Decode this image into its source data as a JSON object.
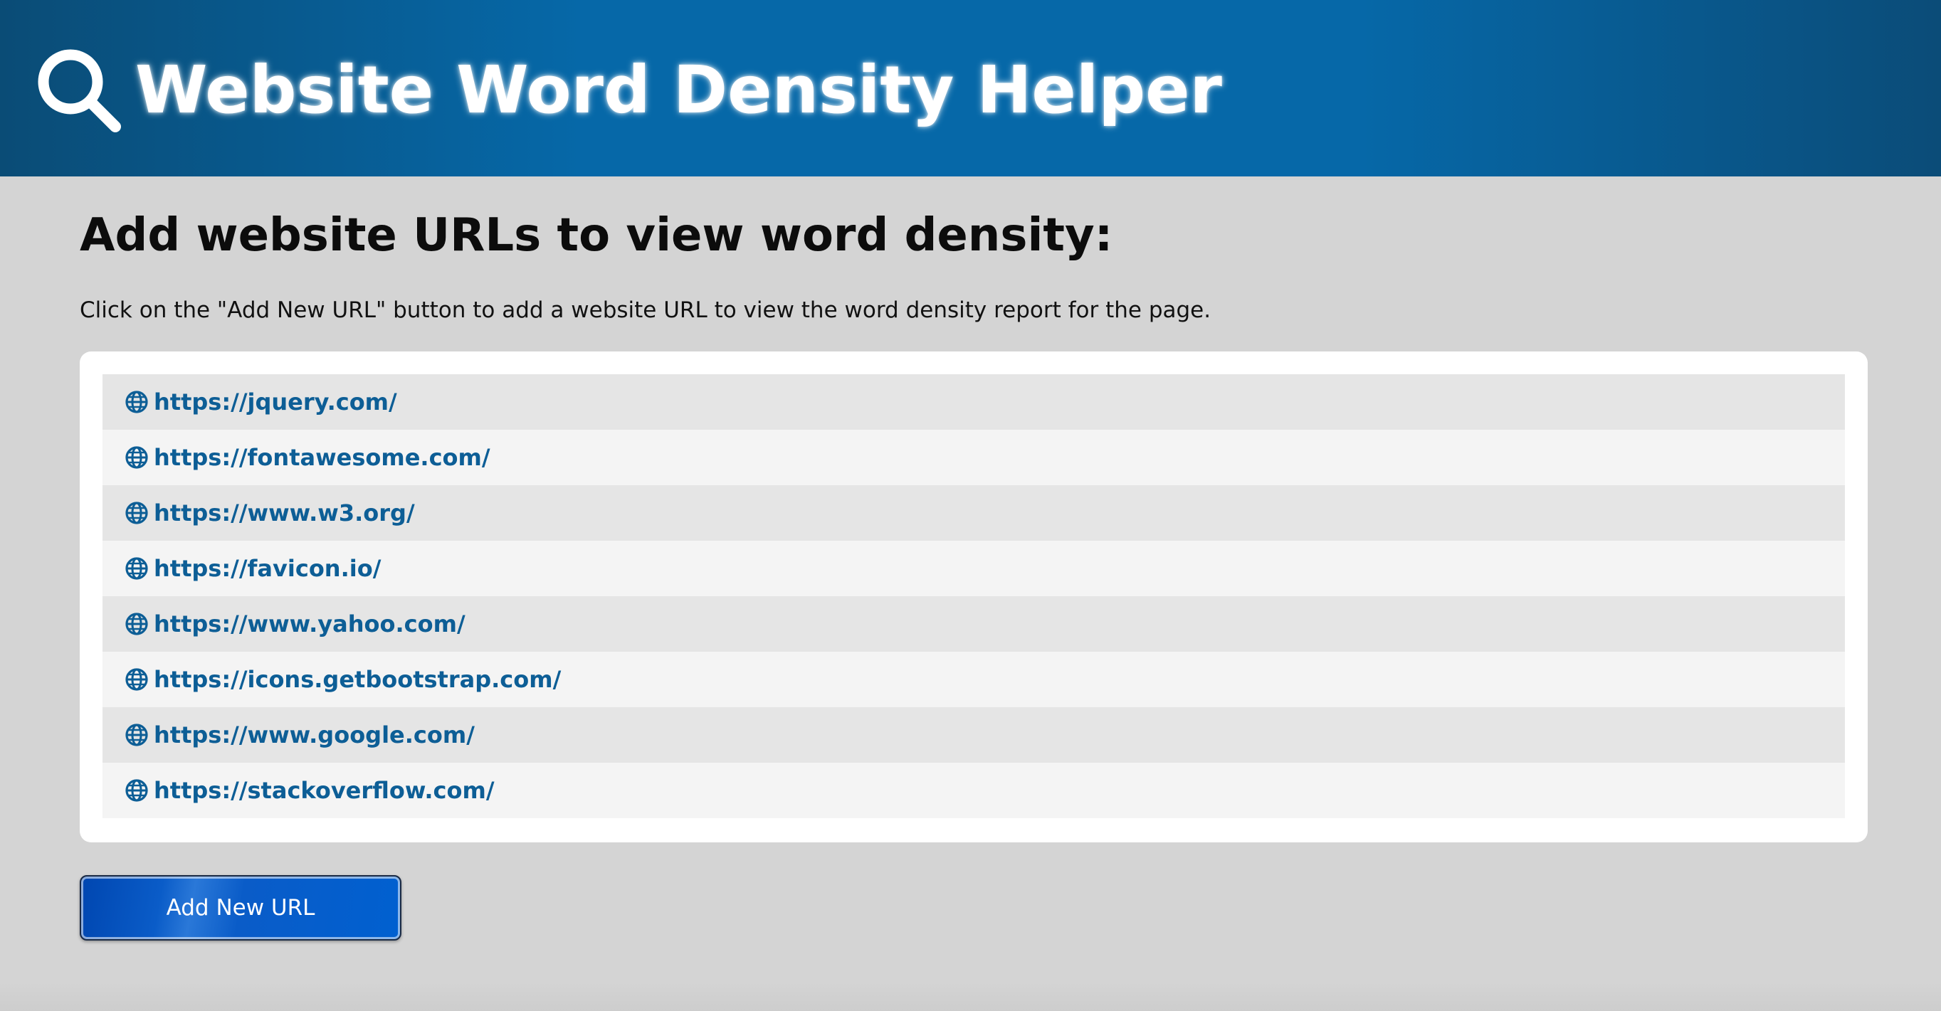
{
  "header": {
    "title": "Website Word Density Helper",
    "icon": "search-icon"
  },
  "main": {
    "heading": "Add website URLs to view word density:",
    "description": "Click on the \"Add New URL\" button to add a website URL to view the word density report for the page.",
    "urls": [
      "https://jquery.com/",
      "https://fontawesome.com/",
      "https://www.w3.org/",
      "https://favicon.io/",
      "https://www.yahoo.com/",
      "https://icons.getbootstrap.com/",
      "https://www.google.com/",
      "https://stackoverflow.com/"
    ],
    "url_icon": "globe-icon",
    "add_button_label": "Add New URL"
  },
  "colors": {
    "header_bg": "#0668a8",
    "link": "#0d5e96",
    "page_bg": "#d4d4d4",
    "button_bg": "#0a5cc8"
  }
}
